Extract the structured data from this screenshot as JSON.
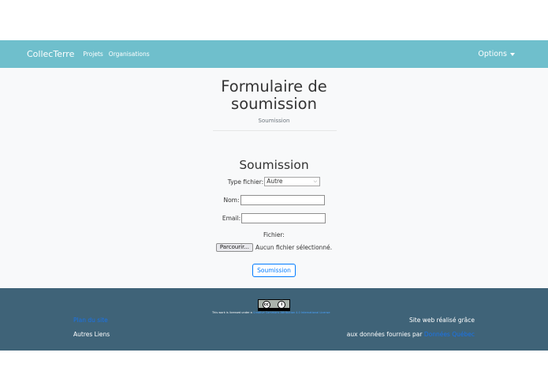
{
  "nav": {
    "brand": "CollecTerre",
    "links": [
      "Projets",
      "Organisations"
    ],
    "options": "Options"
  },
  "header": {
    "title_line1": "Formulaire de",
    "title_line2": "soumission",
    "subtitle": "Soumission"
  },
  "form": {
    "title": "Soumission",
    "type_label": "Type fichier:",
    "type_value": "Autre",
    "nom_label": "Nom:",
    "nom_value": "",
    "email_label": "Email:",
    "email_value": "",
    "fichier_label": "Fichier:",
    "browse_button": "Parcourir...",
    "no_file": "Aucun fichier sélectionné.",
    "submit_button": "Soumission"
  },
  "footer": {
    "license_prefix": "This work is licensed under a",
    "license_link": "Creative Commons Attribution 4.0 International License",
    "site_map": "Plan du site",
    "other_links": "Autres Liens",
    "credit_line1": "Site web réalisé grâce",
    "credit_line2_prefix": "aux données fournies par ",
    "credit_link": "Données Québec"
  },
  "colors": {
    "navbar": "#6fbfcc",
    "footer": "#3f6378",
    "link": "#1a73e8",
    "primary": "#007bff"
  }
}
